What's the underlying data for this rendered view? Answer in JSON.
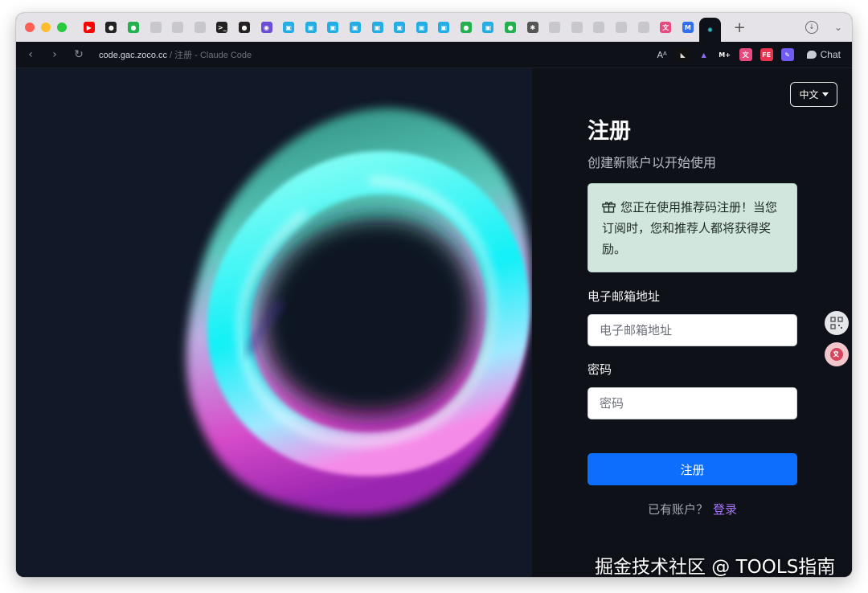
{
  "browser": {
    "tabs": [
      {
        "icon": "youtube-icon",
        "color": "#ff0000"
      },
      {
        "icon": "github-icon",
        "color": "#222222"
      },
      {
        "icon": "wechat-icon",
        "color": "#23b14d"
      },
      {
        "icon": "blank-page-icon",
        "color": "#c8c8cc"
      },
      {
        "icon": "blank-page-icon",
        "color": "#c8c8cc"
      },
      {
        "icon": "blank-page-icon",
        "color": "#c8c8cc"
      },
      {
        "icon": "terminal-icon",
        "color": "#222222"
      },
      {
        "icon": "github-icon",
        "color": "#222222"
      },
      {
        "icon": "purple-circle-icon",
        "color": "#6b4cd6"
      },
      {
        "icon": "bilibili-icon",
        "color": "#23ade5"
      },
      {
        "icon": "bilibili-icon",
        "color": "#23ade5"
      },
      {
        "icon": "bilibili-icon",
        "color": "#23ade5"
      },
      {
        "icon": "bilibili-icon",
        "color": "#23ade5"
      },
      {
        "icon": "bilibili-icon",
        "color": "#23ade5"
      },
      {
        "icon": "bilibili-icon",
        "color": "#23ade5"
      },
      {
        "icon": "bilibili-icon",
        "color": "#23ade5"
      },
      {
        "icon": "bilibili-icon",
        "color": "#23ade5"
      },
      {
        "icon": "wechat-icon",
        "color": "#23b14d"
      },
      {
        "icon": "bilibili-icon",
        "color": "#23ade5"
      },
      {
        "icon": "wechat-icon",
        "color": "#23b14d"
      },
      {
        "icon": "settings-app-icon",
        "color": "#555555"
      },
      {
        "icon": "blank-page-icon",
        "color": "#c8c8cc"
      },
      {
        "icon": "blank-page-icon",
        "color": "#c8c8cc"
      },
      {
        "icon": "blank-page-icon",
        "color": "#c8c8cc"
      },
      {
        "icon": "blank-page-icon",
        "color": "#c8c8cc"
      },
      {
        "icon": "blank-page-icon",
        "color": "#c8c8cc"
      },
      {
        "icon": "translate-app-icon",
        "color": "#e84a7f"
      },
      {
        "icon": "blue-badge-icon",
        "color": "#2f6ff0"
      },
      {
        "icon": "claude-code-icon",
        "color": "#3ec9d6",
        "active": true
      }
    ],
    "new_tab_label": "+",
    "address": {
      "host": "code.gac.zoco.cc",
      "separator": " / ",
      "page_title": "注册 - Claude Code"
    },
    "extensions": [
      "text-size-icon",
      "bird-extension-icon",
      "vpn-extension-icon",
      "m-plus-extension-icon",
      "translate-extension-icon",
      "fe-extension-icon",
      "edit-extension-icon"
    ],
    "chat_label": "Chat"
  },
  "page": {
    "language_button": "中文",
    "title": "注册",
    "subtitle": "创建新账户以开始使用",
    "referral_notice": "您正在使用推荐码注册！当您订阅时，您和推荐人都将获得奖励。",
    "email_label": "电子邮箱地址",
    "email_placeholder": "电子邮箱地址",
    "password_label": "密码",
    "password_placeholder": "密码",
    "submit_label": "注册",
    "login_prompt": "已有账户？",
    "login_link": "登录"
  },
  "watermark": "掘金技术社区 @ TOOLS指南",
  "colors": {
    "primary": "#0d6efd",
    "link": "#a975ff",
    "notice_bg": "#d1e7dd",
    "page_bg": "#0e1118",
    "hero_bg": "#111827"
  }
}
